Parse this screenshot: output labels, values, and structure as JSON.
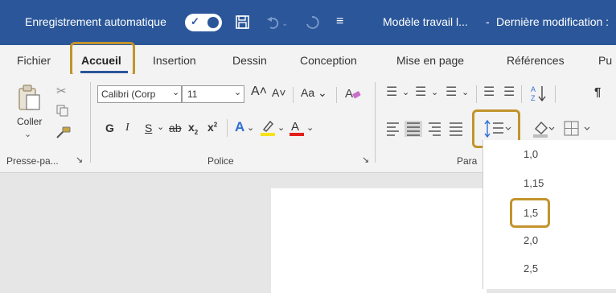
{
  "titlebar": {
    "autosave_label": "Enregistrement automatique",
    "doc_title": "Modèle travail l...",
    "separator": "-",
    "last_modified": "Dernière modification :"
  },
  "tabs": [
    "Fichier",
    "Accueil",
    "Insertion",
    "Dessin",
    "Conception",
    "Mise en page",
    "Références",
    "Pu"
  ],
  "ribbon": {
    "paste_label": "Coller",
    "font_name": "Calibri (Corp",
    "font_size": "11",
    "case_label": "Aa",
    "bold": "G",
    "italic": "I",
    "underline": "S",
    "strike": "ab",
    "subscript": "x",
    "superscript": "x",
    "groups": {
      "clipboard": "Presse-pa...",
      "font": "Police",
      "paragraph": "Para"
    }
  },
  "line_spacing": {
    "options": [
      "1,0",
      "1,15",
      "1,5",
      "2,0",
      "2,5"
    ],
    "selected": "1,5"
  },
  "colors": {
    "title_bar": "#2b579a",
    "highlight": "#c2942c",
    "ribbon": "#f3f3f3"
  }
}
